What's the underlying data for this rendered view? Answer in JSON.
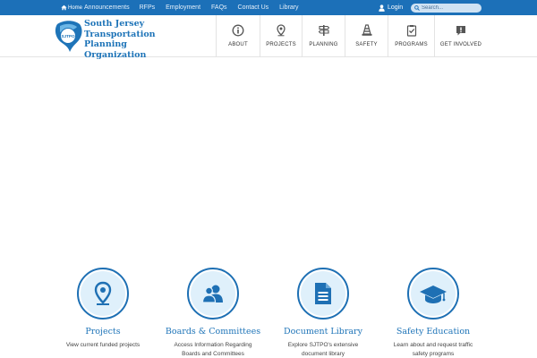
{
  "topbar": {
    "home_label": "Home",
    "links": [
      "Announcements",
      "RFPs",
      "Employment",
      "FAQs",
      "Contact Us",
      "Library"
    ],
    "login_label": "Login",
    "search_placeholder": "Search..."
  },
  "brand": {
    "lines": [
      "South Jersey",
      "Transportation",
      "Planning",
      "Organization"
    ],
    "logo_text": "SJTPO"
  },
  "mainnav": [
    {
      "label": "ABOUT",
      "icon": "info-icon"
    },
    {
      "label": "PROJECTS",
      "icon": "map-pin-icon"
    },
    {
      "label": "PLANNING",
      "icon": "road-sign-icon"
    },
    {
      "label": "SAFETY",
      "icon": "traffic-cone-icon"
    },
    {
      "label": "PROGRAMS",
      "icon": "clipboard-check-icon"
    },
    {
      "label": "GET INVOLVED",
      "icon": "chat-bubble-icon"
    }
  ],
  "features": [
    {
      "title": "Projects",
      "desc": "View current funded projects",
      "icon": "map-pin-icon"
    },
    {
      "title": "Boards & Committees",
      "desc": "Access Information Regarding Boards and Committees",
      "icon": "people-icon"
    },
    {
      "title": "Document Library",
      "desc": "Explore SJTPO's extensive document library",
      "icon": "document-icon"
    },
    {
      "title": "Safety Education",
      "desc": "Learn about and request traffic safety programs",
      "icon": "graduation-cap-icon"
    }
  ],
  "colors": {
    "primary": "#1c70b8",
    "brand_text": "#1e74b8",
    "icon_bg": "#dff0fb",
    "nav_icon": "#555555"
  }
}
